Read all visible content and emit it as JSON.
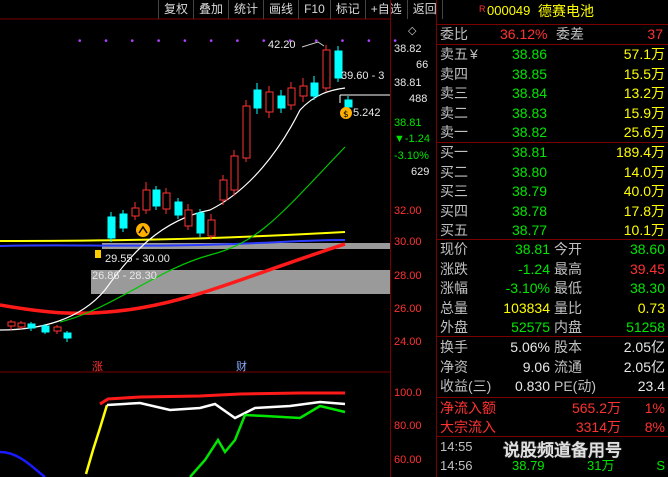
{
  "toolbar": {
    "items": [
      "复权",
      "叠加",
      "统计",
      "画线",
      "F10",
      "标记",
      "+自选",
      "返回"
    ]
  },
  "stock": {
    "badge": "R",
    "code": "000049",
    "name": "德赛电池"
  },
  "chart": {
    "high_label": "42.20",
    "hint_label": "39.60 - 3",
    "low_label": "5.242",
    "zone_upper_label": "29.55 - 30.00",
    "zone_lower_label": "26.86 - 28.30",
    "marker_zhang": "涨",
    "marker_cai": "财",
    "price_axis": {
      "top": "38.82",
      "top_sub": "66",
      "current": "38.81",
      "current_sub": "488",
      "last": "38.81",
      "change": "▼-1.24",
      "change_pct": "-3.10%",
      "volume": "629",
      "ticks": [
        "32.00",
        "30.00",
        "28.00",
        "26.00",
        "24.00"
      ]
    },
    "indicator_axis": {
      "ticks": [
        "100.0",
        "80.00",
        "60.00"
      ]
    }
  },
  "weibi": {
    "label1": "委比",
    "value1": "36.12%",
    "label2": "委差",
    "value2": "37"
  },
  "asks": [
    {
      "label": "卖五",
      "sym": "¥",
      "price": "38.86",
      "vol": "57.1万"
    },
    {
      "label": "卖四",
      "price": "38.85",
      "vol": "15.5万"
    },
    {
      "label": "卖三",
      "price": "38.84",
      "vol": "13.2万"
    },
    {
      "label": "卖二",
      "price": "38.83",
      "vol": "15.9万"
    },
    {
      "label": "卖一",
      "price": "38.82",
      "vol": "25.6万"
    }
  ],
  "bids": [
    {
      "label": "买一",
      "price": "38.81",
      "vol": "189.4万"
    },
    {
      "label": "买二",
      "price": "38.80",
      "vol": "14.0万"
    },
    {
      "label": "买三",
      "price": "38.79",
      "vol": "40.0万"
    },
    {
      "label": "买四",
      "price": "38.78",
      "vol": "17.8万"
    },
    {
      "label": "买五",
      "price": "38.77",
      "vol": "10.1万"
    }
  ],
  "quote": [
    {
      "l1": "现价",
      "v1": "38.81",
      "l2": "今开",
      "v2": "38.60"
    },
    {
      "l1": "涨跌",
      "v1": "-1.24",
      "l2": "最高",
      "v2": "39.45"
    },
    {
      "l1": "涨幅",
      "v1": "-3.10%",
      "l2": "最低",
      "v2": "38.30"
    },
    {
      "l1": "总量",
      "v1": "103834",
      "l2": "量比",
      "v2": "0.73"
    },
    {
      "l1": "外盘",
      "v1": "52575",
      "l2": "内盘",
      "v2": "51258"
    }
  ],
  "stats": [
    {
      "l1": "换手",
      "v1": "5.06%",
      "l2": "股本",
      "v2": "2.05亿"
    },
    {
      "l1": "净资",
      "v1": "9.06",
      "l2": "流通",
      "v2": "2.05亿"
    },
    {
      "l1": "收益(三)",
      "v1": "0.830",
      "l2": "PE(动)",
      "v2": "23.4"
    }
  ],
  "flows": [
    {
      "label": "净流入额",
      "value": "565.2万",
      "pct": "1%"
    },
    {
      "label": "大宗流入",
      "value": "3314万",
      "pct": "8%"
    }
  ],
  "ticks_list": [
    {
      "time": "14:55",
      "price": "",
      "vol": ""
    },
    {
      "time": "14:56",
      "price": "38.79",
      "vol": "31万",
      "flag": "S"
    }
  ],
  "watermark": "说股频道备用号",
  "colors": {
    "up": "#ff3232",
    "down": "#00e600",
    "bg": "#000000",
    "grid": "#7a0000",
    "accent": "#ffff00"
  }
}
